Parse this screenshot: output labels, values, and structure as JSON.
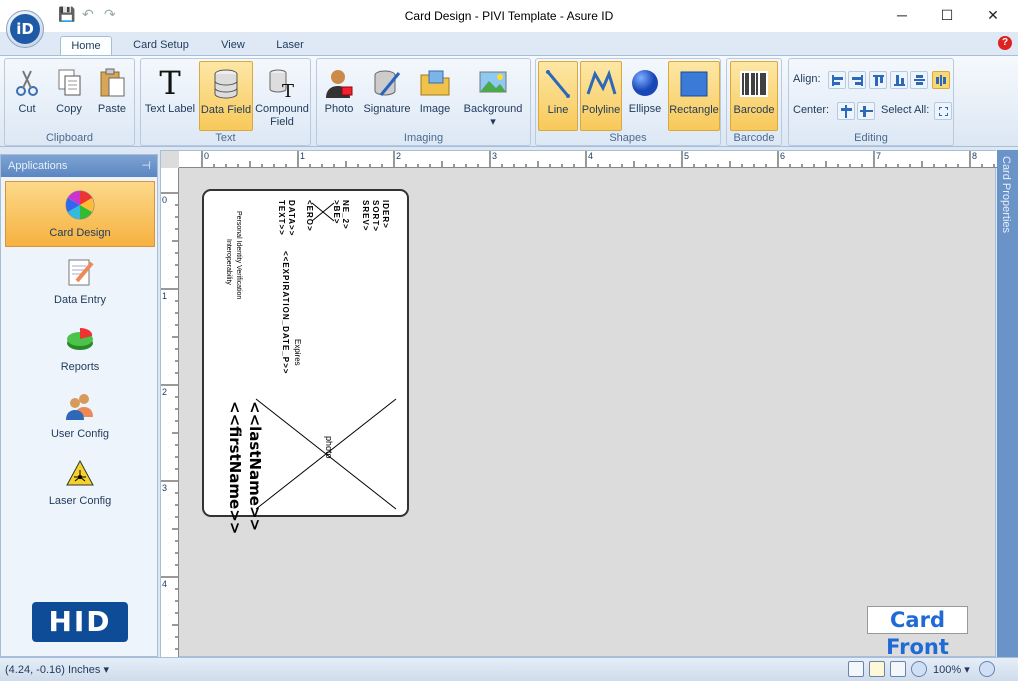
{
  "window": {
    "title": "Card Design - PIVI Template - Asure ID",
    "minimize": "─",
    "maximize": "☐",
    "close": "✕"
  },
  "tabs": [
    {
      "label": "Home"
    },
    {
      "label": "Card Setup"
    },
    {
      "label": "View"
    },
    {
      "label": "Laser"
    }
  ],
  "ribbon": {
    "groups": {
      "clipboard": "Clipboard",
      "text": "Text",
      "imaging": "Imaging",
      "shapes": "Shapes",
      "barcode": "Barcode",
      "editing": "Editing"
    },
    "buttons": {
      "cut": "Cut",
      "copy": "Copy",
      "paste": "Paste",
      "text_label": "Text Label",
      "data_field": "Data Field",
      "compound_field_1": "Compound",
      "compound_field_2": "Field",
      "photo": "Photo",
      "signature": "Signature",
      "image": "Image",
      "background": "Background",
      "line": "Line",
      "polyline": "Polyline",
      "ellipse": "Ellipse",
      "rectangle": "Rectangle",
      "barcode": "Barcode"
    },
    "editing": {
      "align": "Align:",
      "center": "Center:",
      "select_all": "Select All:"
    }
  },
  "sidebar": {
    "header": "Applications",
    "items": [
      {
        "label": "Card Design"
      },
      {
        "label": "Data Entry"
      },
      {
        "label": "Reports"
      },
      {
        "label": "User Config"
      },
      {
        "label": "Laser Config"
      }
    ],
    "brand": "HID"
  },
  "ruler": {
    "h": [
      "0",
      "1",
      "2",
      "3",
      "4",
      "5",
      "6",
      "7",
      "8"
    ],
    "v": [
      "0",
      "1",
      "2",
      "3",
      "4"
    ]
  },
  "card": {
    "fields": {
      "ider": "IDER>",
      "sort": "SORT>",
      "srev": "SREV>",
      "ne2": "NE_2>",
      "ne_b": ">BE>",
      "ero": "<ERO>",
      "data": "DATA>>",
      "text": "TEXT>>",
      "expiration": "<<EXPIRATION_DATE_P>>",
      "expires": "Expires",
      "piv1": "Personal Identity Verification",
      "piv2": "Interoperability",
      "last_name": "<<lastName>>",
      "first_name": "<<firstName>>",
      "photo": "photo"
    },
    "side_label": "Card Front"
  },
  "right_panel": "Card Properties",
  "status": {
    "coords": "(4.24, -0.16) Inches",
    "zoom": "100%"
  }
}
